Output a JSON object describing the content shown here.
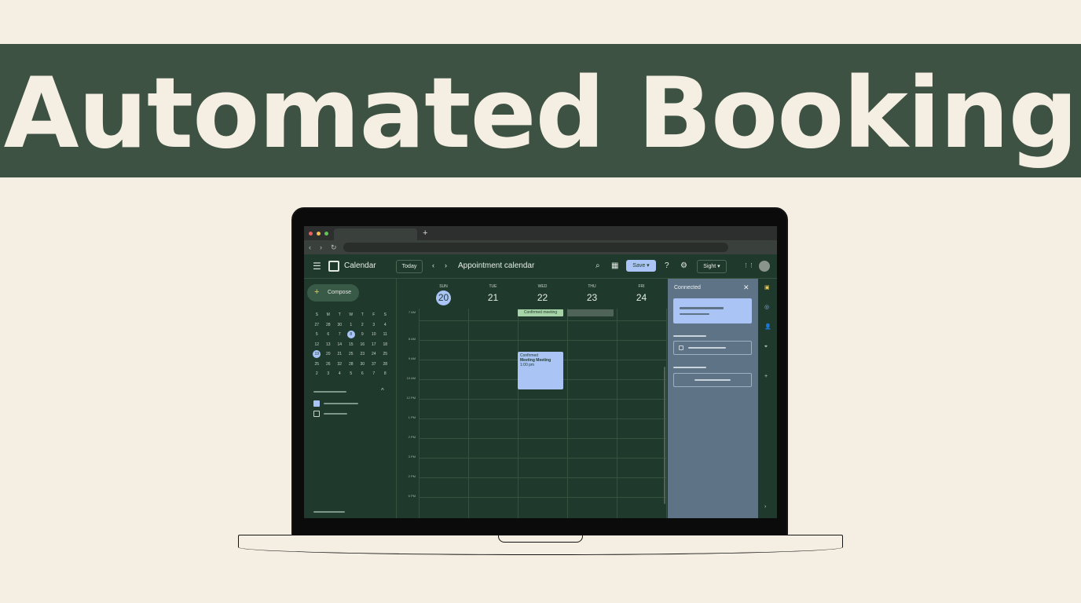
{
  "banner": {
    "title": "Automated Booking"
  },
  "browser": {
    "new_tab": "+",
    "back": "‹",
    "forward": "›",
    "reload": "↻"
  },
  "header": {
    "menu_icon": "☰",
    "app_name": "Calendar",
    "today": "Today",
    "prev": "‹",
    "next": "›",
    "title": "Appointment calendar",
    "search_icon": "⌕",
    "calendar_icon": "▦",
    "save": "Save ▾",
    "help_icon": "?",
    "settings_icon": "⚙",
    "view": "Sight ▾",
    "apps_icon": "⋮⋮"
  },
  "sidebar": {
    "compose": "Compose",
    "compose_plus": "+",
    "collapse_caret": "^",
    "mini_calendar": {
      "weekdays": [
        "S",
        "M",
        "T",
        "W",
        "T",
        "F",
        "S"
      ],
      "rows": [
        [
          "27",
          "28",
          "30",
          "1",
          "2",
          "3",
          "4"
        ],
        [
          "5",
          "6",
          "7",
          "8",
          "9",
          "10",
          "11"
        ],
        [
          "12",
          "13",
          "14",
          "15",
          "16",
          "17",
          "18"
        ],
        [
          "19",
          "20",
          "21",
          "25",
          "23",
          "24",
          "25"
        ],
        [
          "25",
          "26",
          "32",
          "28",
          "30",
          "37",
          "28"
        ],
        [
          "2",
          "3",
          "4",
          "5",
          "6",
          "7",
          "8"
        ]
      ],
      "selected": [
        "8",
        "19"
      ]
    }
  },
  "week": {
    "days": [
      {
        "dow": "SUN",
        "num": "20",
        "current": true
      },
      {
        "dow": "TUE",
        "num": "21",
        "current": false
      },
      {
        "dow": "WED",
        "num": "22",
        "current": false
      },
      {
        "dow": "THU",
        "num": "23",
        "current": false
      },
      {
        "dow": "FRI",
        "num": "24",
        "current": false
      }
    ],
    "hours": [
      "7 AM",
      "8 AM",
      "9 AM",
      "10 AM",
      "12 PM",
      "1 PM",
      "2 PM",
      "3 PM",
      "2 PM",
      "6 PM"
    ],
    "allday_event": "Confirmed meeting",
    "event": {
      "line1": "Confirmed",
      "line2": "Meeting Meeting",
      "line3": "1:00 pm"
    }
  },
  "panel": {
    "title": "Connected",
    "close": "✕"
  },
  "rail": {
    "icons": [
      "▣",
      "◎",
      "👤",
      "⌖",
      "+",
      "›"
    ]
  },
  "colors": {
    "banner": "#3d5243",
    "background": "#f5efe3",
    "app_green": "#1f3a2c",
    "accent_blue": "#a9c4f5",
    "panel": "#5e7385"
  }
}
